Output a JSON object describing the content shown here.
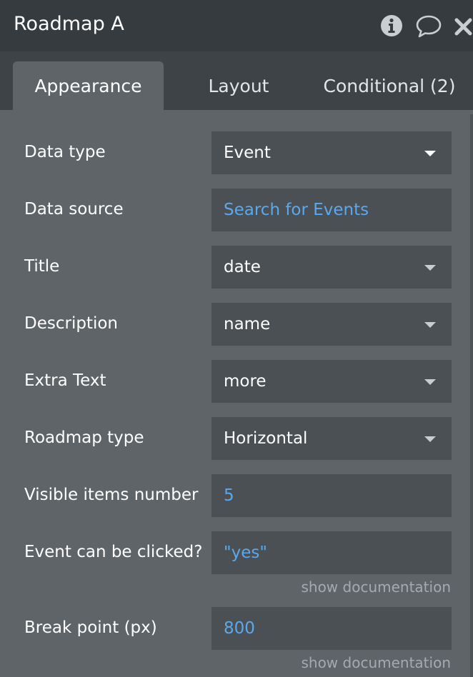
{
  "window": {
    "title": "Roadmap A",
    "icons": [
      "info-icon",
      "comment-icon",
      "close-icon"
    ]
  },
  "tabs": [
    {
      "label": "Appearance",
      "active": true
    },
    {
      "label": "Layout",
      "active": false
    },
    {
      "label": "Conditional (2)",
      "active": false
    }
  ],
  "fields": [
    {
      "label": "Data type",
      "value": "Event",
      "kind": "dropdown"
    },
    {
      "label": "Data source",
      "value": "Search for Events",
      "kind": "dynamic"
    },
    {
      "label": "Title",
      "value": "date",
      "kind": "dropdown"
    },
    {
      "label": "Description",
      "value": "name",
      "kind": "dropdown"
    },
    {
      "label": "Extra Text",
      "value": "more",
      "kind": "dropdown"
    },
    {
      "label": "Roadmap type",
      "value": "Horizontal",
      "kind": "dropdown"
    },
    {
      "label": "Visible items number",
      "value": "5",
      "kind": "dynamic"
    },
    {
      "label": "Event can be clicked?",
      "value": "\"yes\"",
      "kind": "dynamic",
      "doc_link": "show documentation"
    },
    {
      "label": "Break point (px)",
      "value": "800",
      "kind": "dynamic",
      "doc_link": "show documentation"
    }
  ],
  "colors": {
    "panel_bg": "#5e6468",
    "titlebar_bg": "#353b3f",
    "tabbar_bg": "#3d4347",
    "field_bg": "#4b5054",
    "dynamic_text": "#5ba8ec",
    "doc_link_text": "#a4abb0"
  }
}
